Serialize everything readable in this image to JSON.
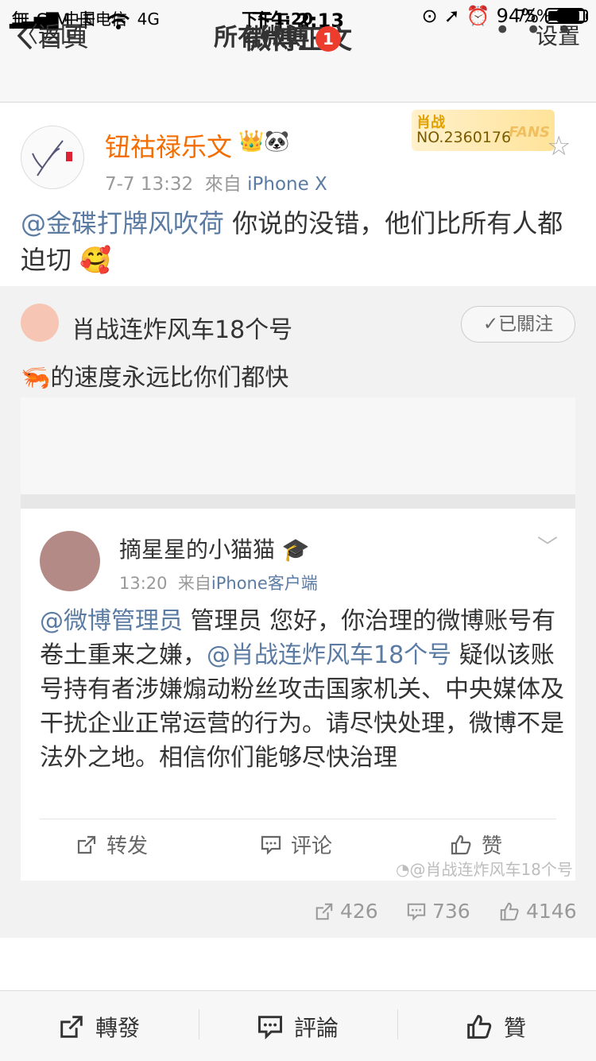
{
  "status_bar": {
    "carrier": "無 SIM 卡",
    "time": "下午 2:13",
    "battery": "94%",
    "battery_level": 0.94
  },
  "nav": {
    "back_label": "首頁",
    "title": "微博正文",
    "more_icon": "more-icon"
  },
  "post": {
    "author": "钮祜禄乐文",
    "time": "7-7 13:32",
    "source_prefix": "來自",
    "source": "iPhone X",
    "fans_badge": {
      "name": "肖战",
      "number": "NO.2360176",
      "word": "FANS"
    },
    "mention": "@金碟打牌风吹荷",
    "text": " 你说的没错，他们比所有人都迫切"
  },
  "repost": {
    "author": "肖战连炸风车18个号",
    "follow_label": "已關注",
    "text": "的速度永远比你们都快"
  },
  "embedded": {
    "carrier": "中国电信",
    "network": "4G",
    "time": "下午1:20",
    "battery": "75%",
    "battery_level": 0.75,
    "back_label": "返回",
    "title": "所有微博",
    "badge": "1",
    "settings_label": "设置",
    "author": "摘星星的小猫猫",
    "time_posted": "13:20",
    "source_prefix": "来自",
    "source": "iPhone客户端",
    "mention1": "@微博管理员",
    "text1": " 管理员 您好，你治理的微博账号有卷土重来之嫌，",
    "mention2": "@肖战连炸风车18个号",
    "text2": " 疑似该账号持有者涉嫌煽动粉丝攻击国家机关、中央媒体及干扰企业正常运营的行为。请尽快处理，微博不是法外之地。相信你们能够尽快治理",
    "actions": {
      "repost": "转发",
      "comment": "评论",
      "like": "赞"
    },
    "watermark": "@肖战连炸风车18个号"
  },
  "counts": {
    "reposts": "426",
    "comments": "736",
    "likes": "4146"
  },
  "bottom_bar": {
    "repost": "轉發",
    "comment": "評論",
    "like": "贊"
  }
}
